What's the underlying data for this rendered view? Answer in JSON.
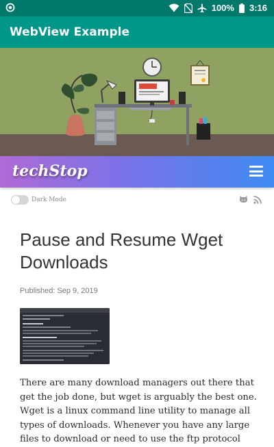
{
  "status_bar": {
    "battery_percent": "100%",
    "time": "3:16",
    "icons": [
      "notification-dot-icon",
      "wifi-icon",
      "no-sim-icon",
      "airplane-icon",
      "battery-icon"
    ]
  },
  "app_bar": {
    "title": "WebView Example"
  },
  "site": {
    "logo": "techStop",
    "menu_icon": "hamburger-menu-icon",
    "header_colors": [
      "#b06ad6",
      "#3f8bf3"
    ]
  },
  "dark_mode": {
    "label": "Dark Mode",
    "enabled": false
  },
  "social_icons": [
    "github-icon",
    "rss-icon"
  ],
  "article": {
    "title": "Pause and Resume Wget Downloads",
    "published": "Published: Sep 9, 2019",
    "body": "There are many download managers out there that get the job done, but wget is arguably the best one. Wget is a linux command line utility to manage all types of downloads. Whenever you have any large files to download or need to use the ftp protocol"
  },
  "colors": {
    "status_bar": "#00796b",
    "app_bar": "#009688"
  }
}
